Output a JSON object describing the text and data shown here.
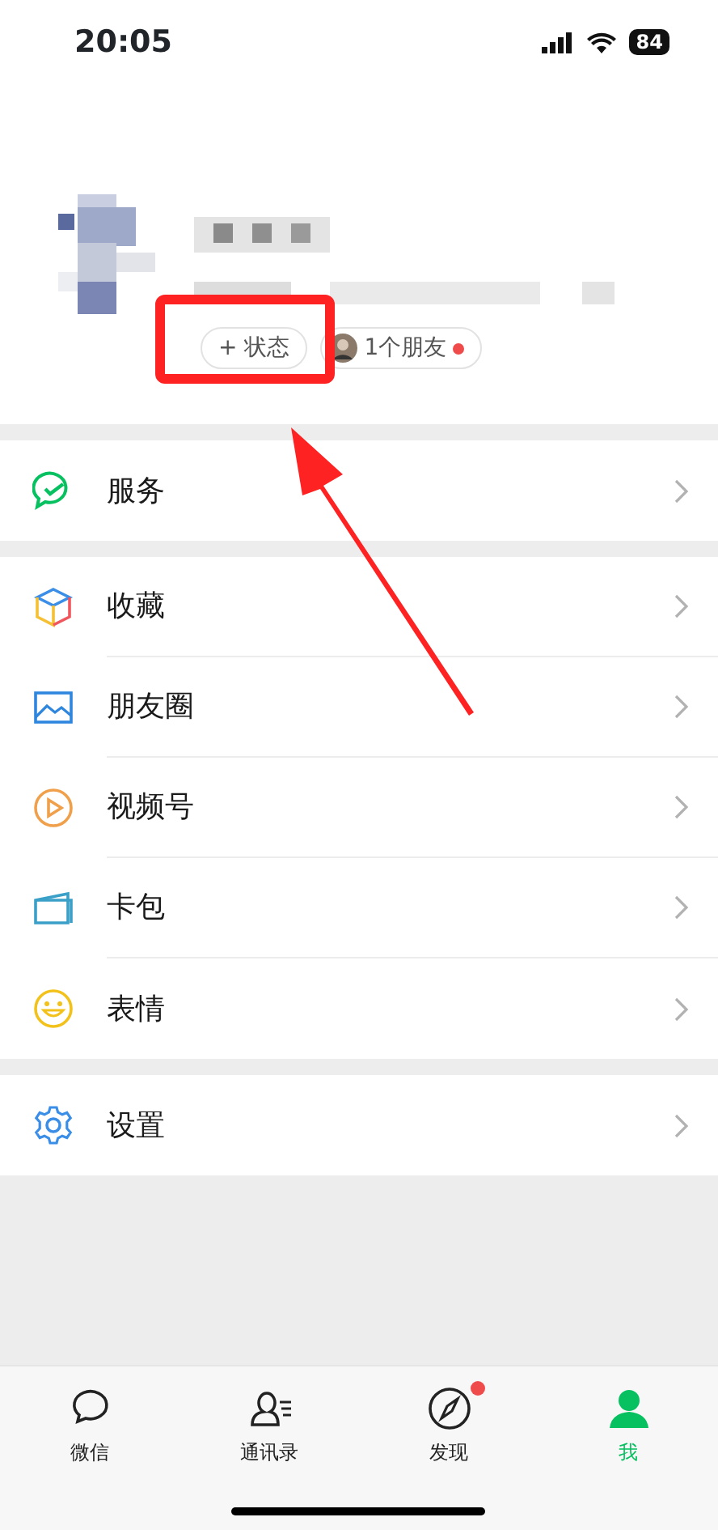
{
  "status_bar": {
    "time": "20:05",
    "battery": "84"
  },
  "profile": {
    "status_button": "+ 状态",
    "friends_chip": {
      "label": "1个朋友",
      "new_dot": true
    }
  },
  "menu_groups": [
    [
      {
        "kind": "service",
        "label": "服务"
      }
    ],
    [
      {
        "kind": "favorites",
        "label": "收藏"
      },
      {
        "kind": "moments",
        "label": "朋友圈"
      },
      {
        "kind": "channels",
        "label": "视频号"
      },
      {
        "kind": "cards",
        "label": "卡包"
      },
      {
        "kind": "stickers",
        "label": "表情"
      }
    ],
    [
      {
        "kind": "settings",
        "label": "设置"
      }
    ]
  ],
  "tabs": [
    {
      "kind": "chats",
      "label": "微信",
      "selected": false,
      "dot": false
    },
    {
      "kind": "contacts",
      "label": "通讯录",
      "selected": false,
      "dot": false
    },
    {
      "kind": "discover",
      "label": "发现",
      "selected": false,
      "dot": true
    },
    {
      "kind": "me",
      "label": "我",
      "selected": true,
      "dot": false
    }
  ]
}
